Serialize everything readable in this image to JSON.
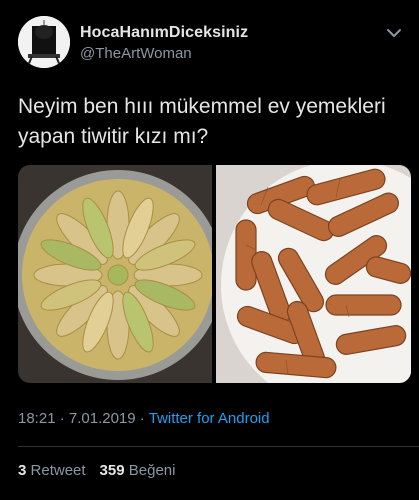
{
  "user": {
    "display_name": "HocaHanımDiceksiniz",
    "handle": "@TheArtWoman"
  },
  "tweet": {
    "text": "Neyim ben hııı mükemmel ev yemekleri yapan tiwitir kızı mı?"
  },
  "meta": {
    "time": "18:21",
    "separator": "·",
    "date": "7.01.2019",
    "app": "Twitter for Android"
  },
  "stats": {
    "retweets_count": "3",
    "retweets_label": "Retweet",
    "likes_count": "359",
    "likes_label": "Beğeni"
  },
  "icons": {
    "menu": "chevron-down-icon",
    "avatar": "avatar"
  },
  "colors": {
    "background": "#000000",
    "link": "#1da1f2",
    "secondary": "#8b98a5"
  }
}
